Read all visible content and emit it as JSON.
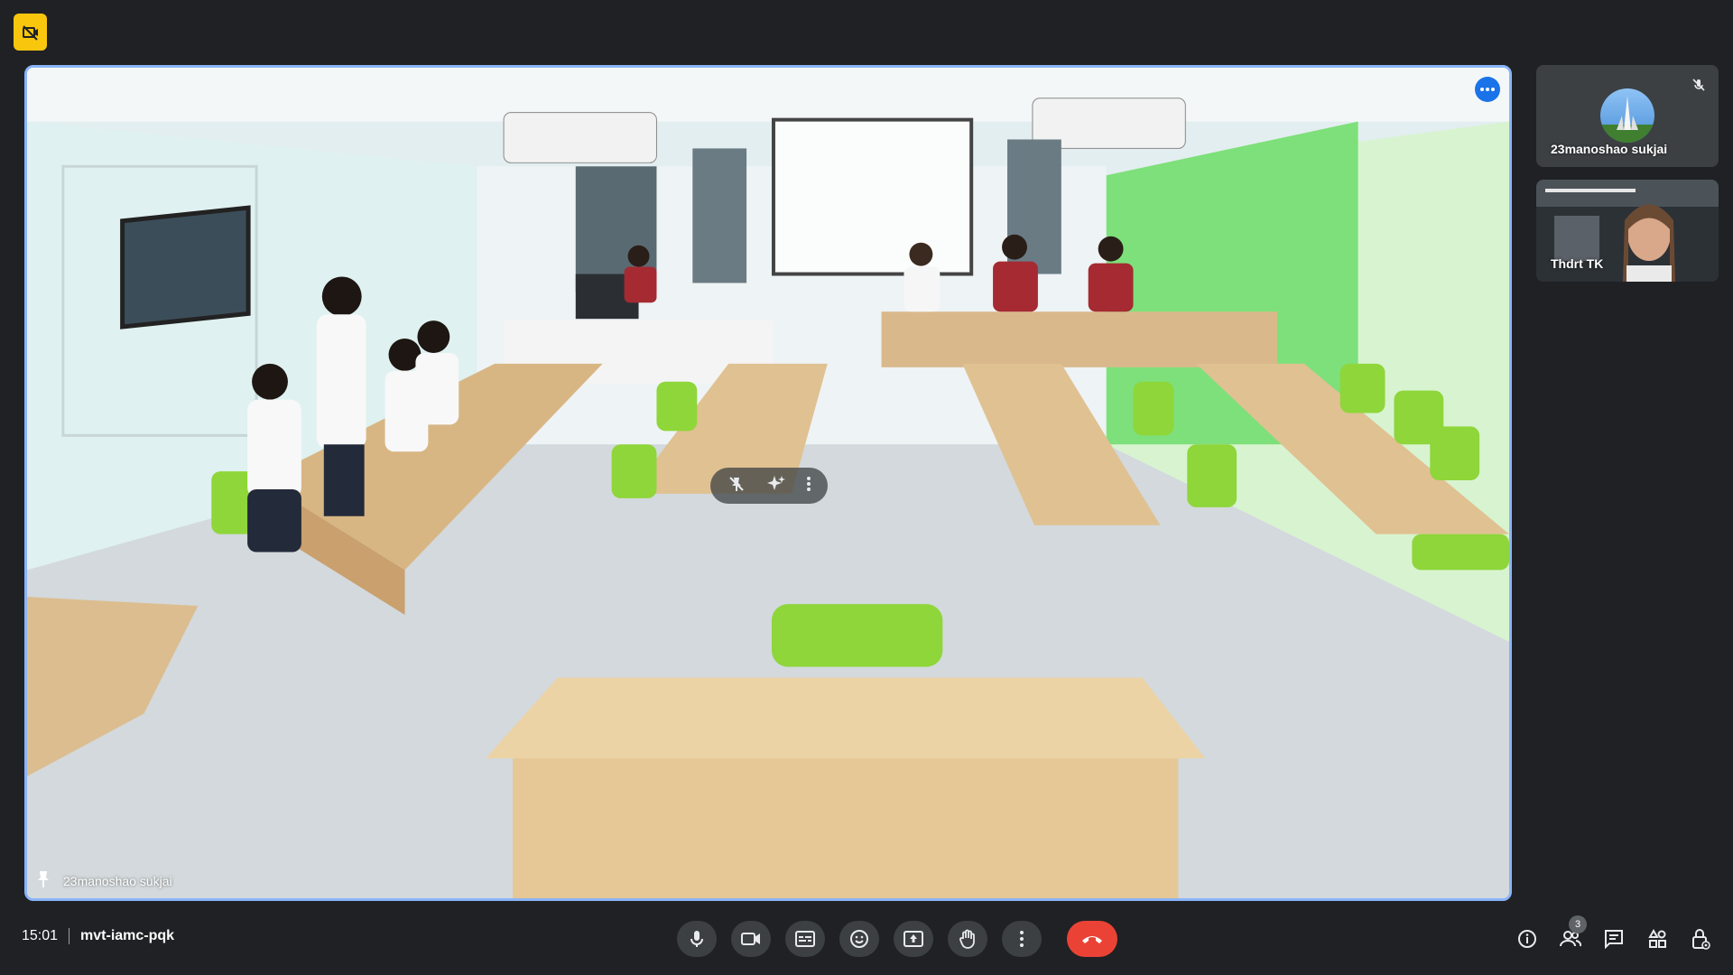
{
  "meeting": {
    "time": "15:01",
    "code": "mvt-iamc-pqk"
  },
  "main_tile": {
    "participant_name": "23manoshao sukjai",
    "pin_icon": "pin-icon",
    "more_icon": "more-horizontal-icon"
  },
  "participants": [
    {
      "name": "23manoshao sukjai",
      "muted": true,
      "avatar_icon": "monument-avatar"
    },
    {
      "name": "Thdrt TK",
      "muted": false
    }
  ],
  "tile_overlay_icons": [
    "pin-off-icon",
    "sparkle-effects-icon",
    "more-vertical-icon"
  ],
  "controls": [
    {
      "name": "mic",
      "icon": "mic-icon"
    },
    {
      "name": "camera",
      "icon": "videocam-icon"
    },
    {
      "name": "captions",
      "icon": "captions-icon"
    },
    {
      "name": "reactions",
      "icon": "emoji-icon"
    },
    {
      "name": "present",
      "icon": "present-screen-icon"
    },
    {
      "name": "raise-hand",
      "icon": "hand-icon"
    },
    {
      "name": "more",
      "icon": "more-vertical-icon"
    },
    {
      "name": "leave",
      "icon": "call-end-icon",
      "color": "#ea4335"
    }
  ],
  "right_panel": {
    "people_count": "3",
    "icons": [
      "info-icon",
      "people-icon",
      "chat-icon",
      "activities-icon",
      "host-controls-icon"
    ]
  },
  "colors": {
    "background": "#202124",
    "accent": "#8ab4f8",
    "recording_badge": "#f9c60e",
    "hangup": "#ea4335"
  }
}
